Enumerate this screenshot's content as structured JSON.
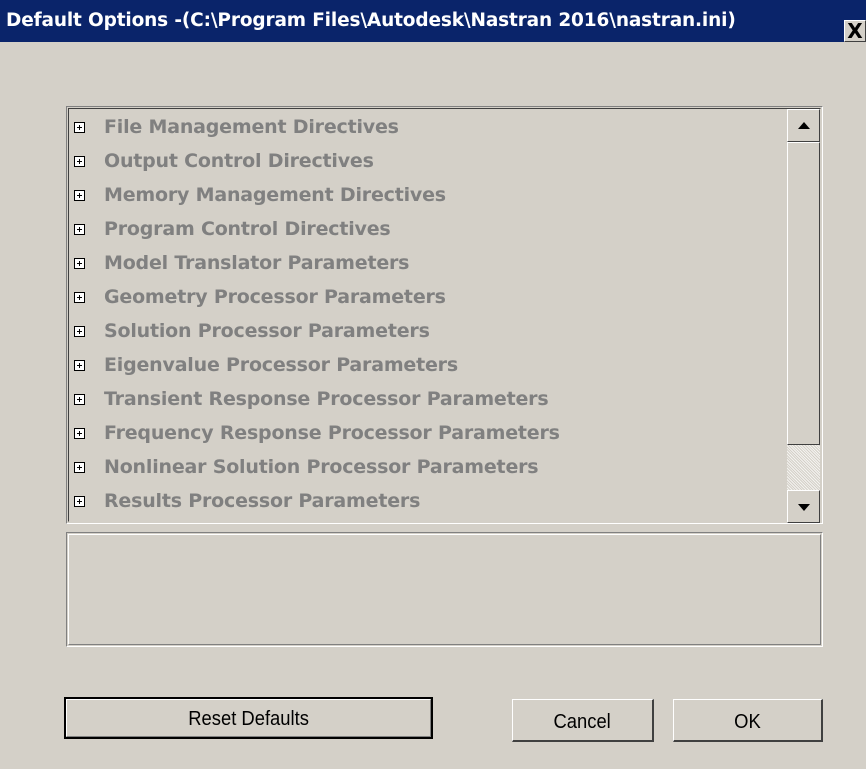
{
  "window": {
    "title": "Default Options -(C:\\Program Files\\Autodesk\\Nastran 2016\\nastran.ini)",
    "close_label": "X"
  },
  "tree": {
    "items": [
      {
        "label": "File Management Directives",
        "expanded": false
      },
      {
        "label": "Output Control Directives",
        "expanded": false
      },
      {
        "label": "Memory Management Directives",
        "expanded": false
      },
      {
        "label": "Program Control Directives",
        "expanded": false
      },
      {
        "label": "Model Translator Parameters",
        "expanded": false
      },
      {
        "label": "Geometry Processor Parameters",
        "expanded": false
      },
      {
        "label": "Solution Processor Parameters",
        "expanded": false
      },
      {
        "label": "Eigenvalue Processor Parameters",
        "expanded": false
      },
      {
        "label": "Transient Response Processor Parameters",
        "expanded": false
      },
      {
        "label": "Frequency Response Processor Parameters",
        "expanded": false
      },
      {
        "label": "Nonlinear Solution Processor Parameters",
        "expanded": false
      },
      {
        "label": "Results Processor Parameters",
        "expanded": false
      }
    ],
    "expander_icon": "plus-box-icon",
    "item_color": "#808080"
  },
  "description": {
    "text": ""
  },
  "buttons": {
    "reset_label": "Reset Defaults",
    "cancel_label": "Cancel",
    "ok_label": "OK"
  },
  "colors": {
    "titlebar": "#0a246a",
    "face": "#d4d0c8"
  }
}
